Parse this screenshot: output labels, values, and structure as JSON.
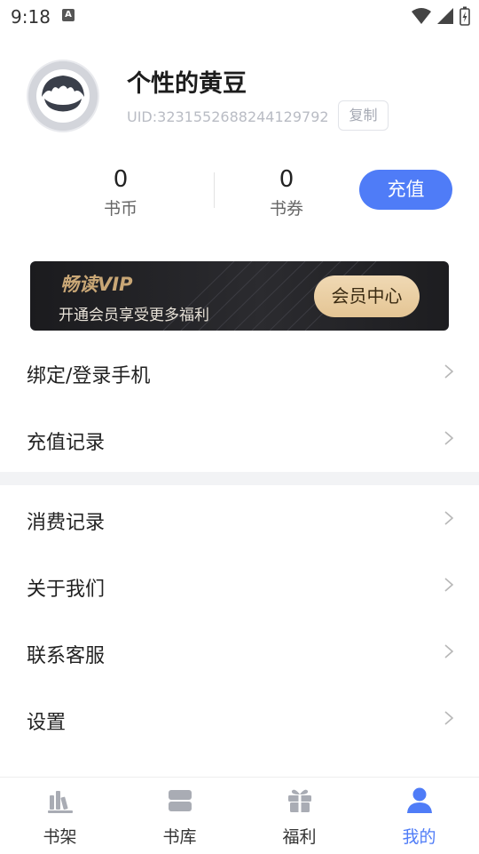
{
  "status_bar": {
    "time": "9:18",
    "notification_letter": "A"
  },
  "profile": {
    "username": "个性的黄豆",
    "uid": "UID:3231552688244129792",
    "copy_label": "复制"
  },
  "stats": [
    {
      "value": "0",
      "label": "书币"
    },
    {
      "value": "0",
      "label": "书券"
    }
  ],
  "recharge_label": "充值",
  "vip": {
    "title": "畅读VIP",
    "subtitle": "开通会员享受更多福利",
    "button_label": "会员中心"
  },
  "menu_group_1": [
    {
      "label": "绑定/登录手机"
    },
    {
      "label": "充值记录"
    }
  ],
  "menu_group_2": [
    {
      "label": "消费记录"
    },
    {
      "label": "关于我们"
    },
    {
      "label": "联系客服"
    },
    {
      "label": "设置"
    }
  ],
  "chevron_glyph": ">",
  "bottom_nav": [
    {
      "label": "书架",
      "icon": "bookshelf-icon",
      "active": false
    },
    {
      "label": "书库",
      "icon": "library-icon",
      "active": false
    },
    {
      "label": "福利",
      "icon": "gift-icon",
      "active": false
    },
    {
      "label": "我的",
      "icon": "user-icon",
      "active": true
    }
  ],
  "colors": {
    "accent": "#4f7cf7",
    "vip_gold": "#c9a776",
    "separator": "#f2f3f5"
  }
}
